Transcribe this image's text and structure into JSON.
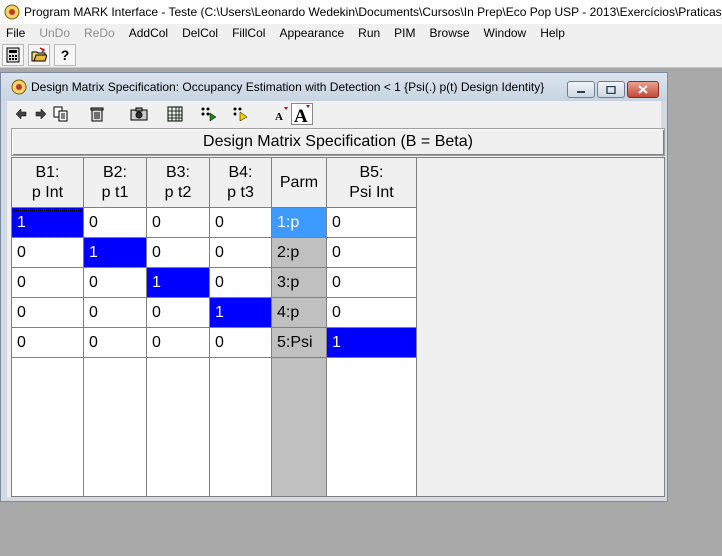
{
  "app": {
    "title": "Program MARK Interface - Teste  (C:\\Users\\Leonardo Wedekin\\Documents\\Cursos\\In Prep\\Eco Pop USP - 2013\\Exercícios\\Praticas_s",
    "icon": "mark-app-icon"
  },
  "menu": [
    {
      "label": "File",
      "enabled": true
    },
    {
      "label": "UnDo",
      "enabled": false
    },
    {
      "label": "ReDo",
      "enabled": false
    },
    {
      "label": "AddCol",
      "enabled": true
    },
    {
      "label": "DelCol",
      "enabled": true
    },
    {
      "label": "FillCol",
      "enabled": true
    },
    {
      "label": "Appearance",
      "enabled": true
    },
    {
      "label": "Run",
      "enabled": true
    },
    {
      "label": "PIM",
      "enabled": true
    },
    {
      "label": "Browse",
      "enabled": true
    },
    {
      "label": "Window",
      "enabled": true
    },
    {
      "label": "Help",
      "enabled": true
    }
  ],
  "toolbar": {
    "help_label": "?"
  },
  "child_window": {
    "title": "Design Matrix Specification: Occupancy Estimation with Detection < 1  {Psi(.) p(t) Design Identity}"
  },
  "matrix": {
    "header": "Design Matrix Specification (B = Beta)",
    "columns": [
      {
        "line1": "B1:",
        "line2": "p Int"
      },
      {
        "line1": "B2:",
        "line2": "p t1"
      },
      {
        "line1": "B3:",
        "line2": "p t2"
      },
      {
        "line1": "B4:",
        "line2": "p t3"
      },
      {
        "line1": "Parm",
        "line2": ""
      },
      {
        "line1": "B5:",
        "line2": "Psi Int"
      }
    ],
    "rows": [
      [
        "1",
        "0",
        "0",
        "0",
        "1:p",
        "0"
      ],
      [
        "0",
        "1",
        "0",
        "0",
        "2:p",
        "0"
      ],
      [
        "0",
        "0",
        "1",
        "0",
        "3:p",
        "0"
      ],
      [
        "0",
        "0",
        "0",
        "1",
        "4:p",
        "0"
      ],
      [
        "0",
        "0",
        "0",
        "0",
        "5:Psi",
        "1"
      ]
    ],
    "highlighted_cells": [
      [
        0,
        0
      ],
      [
        1,
        1
      ],
      [
        2,
        2
      ],
      [
        3,
        3
      ],
      [
        4,
        5
      ]
    ],
    "selected_parm_row": 0,
    "colors": {
      "diagonal": "#0000ff",
      "parm_selected": "#3d9bff",
      "parm_column": "#c0c0c0"
    }
  }
}
